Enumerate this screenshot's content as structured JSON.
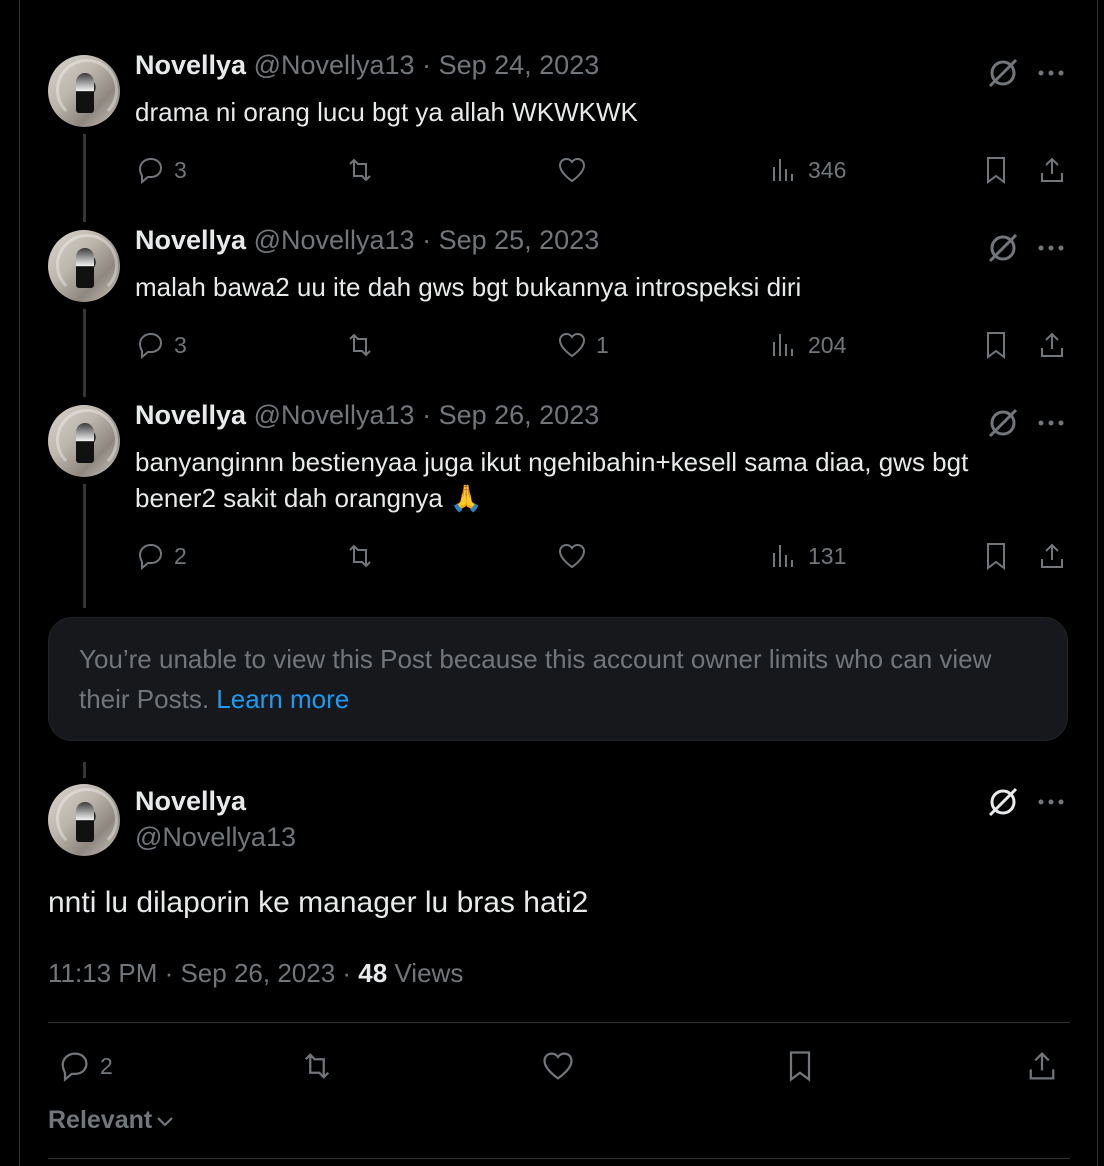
{
  "tweets": [
    {
      "name": "Novellya",
      "handle": "@Novellya13",
      "date": "· Sep 24, 2023",
      "text": "drama ni orang lucu bgt ya allah WKWKWK",
      "replies": "3",
      "retweets": "",
      "likes": "",
      "views": "346"
    },
    {
      "name": "Novellya",
      "handle": "@Novellya13",
      "date": "· Sep 25, 2023",
      "text": "malah bawa2 uu ite dah gws bgt bukannya introspeksi diri",
      "replies": "3",
      "retweets": "",
      "likes": "1",
      "views": "204"
    },
    {
      "name": "Novellya",
      "handle": "@Novellya13",
      "date": "· Sep 26, 2023",
      "text": "banyanginnn bestienyaa juga ikut ngehibahin+kesell sama diaa, gws bgt bener2 sakit dah orangnya 🙏",
      "replies": "2",
      "retweets": "",
      "likes": "",
      "views": "131"
    }
  ],
  "notice": {
    "text": "You’re unable to view this Post because this account owner limits who can view their Posts.",
    "link": "Learn more"
  },
  "main_post": {
    "name": "Novellya",
    "handle": "@Novellya13",
    "text": "nnti lu dilaporin ke manager lu bras hati2",
    "time": "11:13 PM · Sep 26, 2023 ·",
    "views_count": "48",
    "views_label": "Views",
    "replies": "2"
  },
  "sort_label": "Relevant",
  "icons": {
    "reply": "reply-icon",
    "retweet": "retweet-icon",
    "like": "heart-icon",
    "views": "views-icon",
    "bookmark": "bookmark-icon",
    "share": "share-icon",
    "grok": "grok-icon",
    "more": "more-icon"
  },
  "colors": {
    "background": "#000000",
    "text": "#e7e9ea",
    "muted": "#71767b",
    "link": "#1d9bf0",
    "notice_bg": "#16181c",
    "border": "#2f3336"
  }
}
